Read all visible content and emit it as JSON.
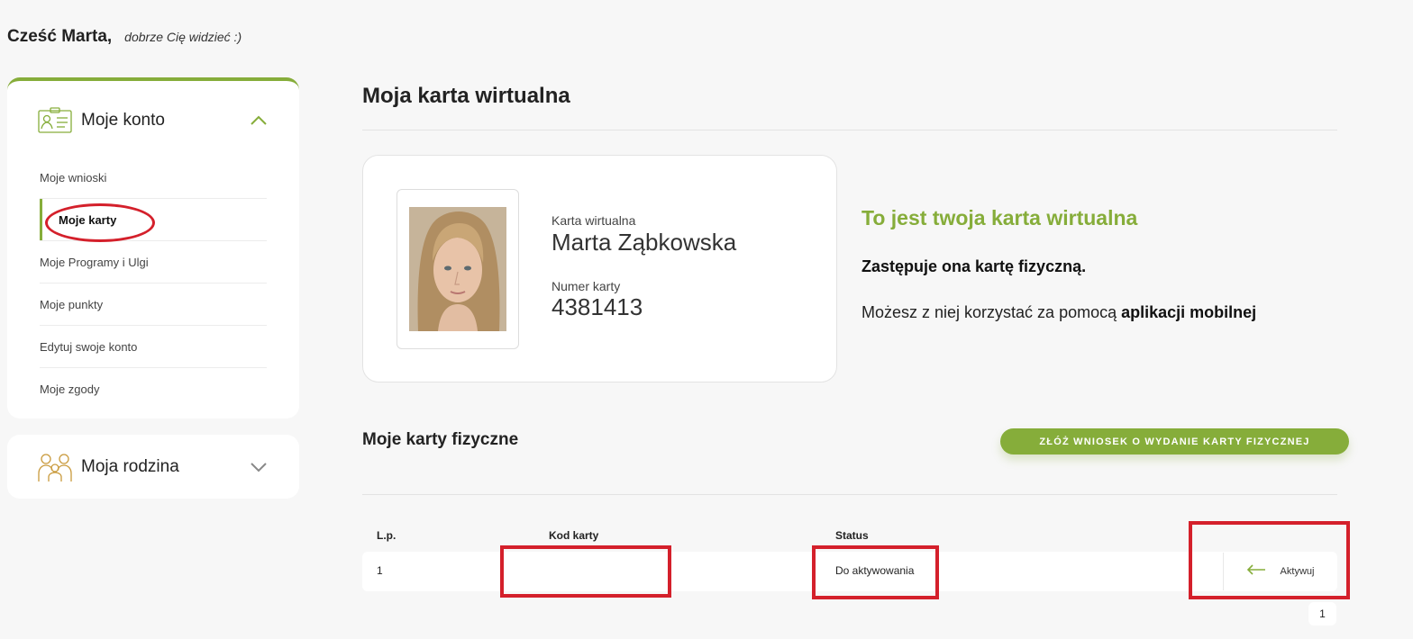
{
  "greeting": {
    "hello": "Cześć Marta,",
    "sub": "dobrze Cię widzieć :)"
  },
  "sidebar": {
    "account": {
      "title": "Moje konto",
      "icon": "id-card-icon",
      "items": [
        {
          "label": "Moje wnioski",
          "active": false
        },
        {
          "label": "Moje karty",
          "active": true
        },
        {
          "label": "Moje Programy i Ulgi",
          "active": false
        },
        {
          "label": "Moje punkty",
          "active": false
        },
        {
          "label": "Edytuj swoje konto",
          "active": false
        },
        {
          "label": "Moje zgody",
          "active": false
        }
      ]
    },
    "family": {
      "title": "Moja rodzina",
      "icon": "family-icon"
    }
  },
  "main": {
    "title": "Moja karta wirtualna",
    "virtual_card": {
      "type_label": "Karta wirtualna",
      "holder_name": "Marta Ząbkowska",
      "number_label": "Numer karty",
      "number": "4381413"
    },
    "promo": {
      "title": "To jest twoja karta wirtualna",
      "line1": "Zastępuje ona kartę fizyczną.",
      "line2_prefix": "Możesz z niej korzystać za pomocą",
      "line2_bold": "aplikacji mobilnej"
    },
    "physical": {
      "title": "Moje karty fizyczne",
      "apply_button": "ZŁÓŻ WNIOSEK O WYDANIE KARTY FIZYCZNEJ",
      "columns": {
        "lp": "L.p.",
        "code": "Kod karty",
        "status": "Status"
      },
      "rows": [
        {
          "lp": "1",
          "code": "",
          "status": "Do aktywowania",
          "action": "Aktywuj"
        }
      ],
      "pagination": "1"
    }
  },
  "colors": {
    "accent": "#86ad3a",
    "highlight": "#d4202b"
  }
}
